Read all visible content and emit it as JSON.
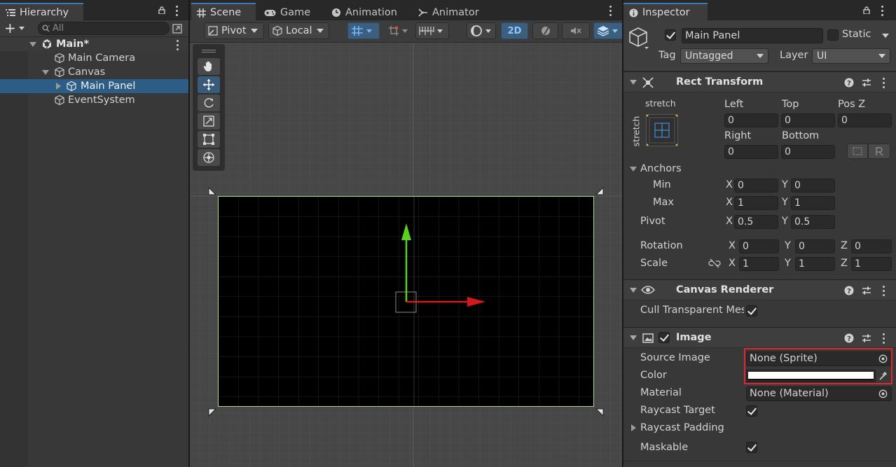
{
  "hierarchy": {
    "tab_label": "Hierarchy",
    "add_label": "+",
    "search_placeholder": "All",
    "scene_name": "Main*",
    "items": [
      {
        "label": "Main Camera"
      },
      {
        "label": "Canvas"
      },
      {
        "label": "Main Panel"
      },
      {
        "label": "EventSystem"
      }
    ]
  },
  "scene_tabs": [
    {
      "label": "Scene",
      "icon": "grid-icon"
    },
    {
      "label": "Game",
      "icon": "gamepad-icon"
    },
    {
      "label": "Animation",
      "icon": "clock-icon"
    },
    {
      "label": "Animator",
      "icon": "animator-icon"
    }
  ],
  "scene_toolbar": {
    "pivot_label": "Pivot",
    "local_label": "Local",
    "mode_2d_label": "2D"
  },
  "inspector": {
    "tab_label": "Inspector",
    "object_name": "Main Panel",
    "static_label": "Static",
    "tag_label": "Tag",
    "tag_value": "Untagged",
    "layer_label": "Layer",
    "layer_value": "UI",
    "rect_transform": {
      "title": "Rect Transform",
      "preset_top": "stretch",
      "preset_side": "stretch",
      "left_label": "Left",
      "left_value": "0",
      "top_label": "Top",
      "top_value": "0",
      "posz_label": "Pos Z",
      "posz_value": "0",
      "right_label": "Right",
      "right_value": "0",
      "bottom_label": "Bottom",
      "bottom_value": "0",
      "anchors_label": "Anchors",
      "min_label": "Min",
      "min_x": "0",
      "min_y": "0",
      "max_label": "Max",
      "max_x": "1",
      "max_y": "1",
      "pivot_label": "Pivot",
      "pivot_x": "0.5",
      "pivot_y": "0.5",
      "rotation_label": "Rotation",
      "rot_x": "0",
      "rot_y": "0",
      "rot_z": "0",
      "scale_label": "Scale",
      "scale_x": "1",
      "scale_y": "1",
      "scale_z": "1",
      "x_label": "X",
      "y_label": "Y",
      "z_label": "Z"
    },
    "canvas_renderer": {
      "title": "Canvas Renderer",
      "cull_label": "Cull Transparent Mes"
    },
    "image": {
      "title": "Image",
      "source_label": "Source Image",
      "source_value": "None (Sprite)",
      "color_label": "Color",
      "color_value": "#ffffff",
      "material_label": "Material",
      "material_value": "None (Material)",
      "raycast_target_label": "Raycast Target",
      "raycast_padding_label": "Raycast Padding",
      "maskable_label": "Maskable"
    }
  },
  "colors": {
    "selection": "#2c5d87",
    "highlight_box": "#e0262b",
    "panel_fill": "#000000",
    "panel_border": "#a6d98a",
    "gizmo_y": "#5ad11a",
    "gizmo_x": "#d11a1a"
  }
}
